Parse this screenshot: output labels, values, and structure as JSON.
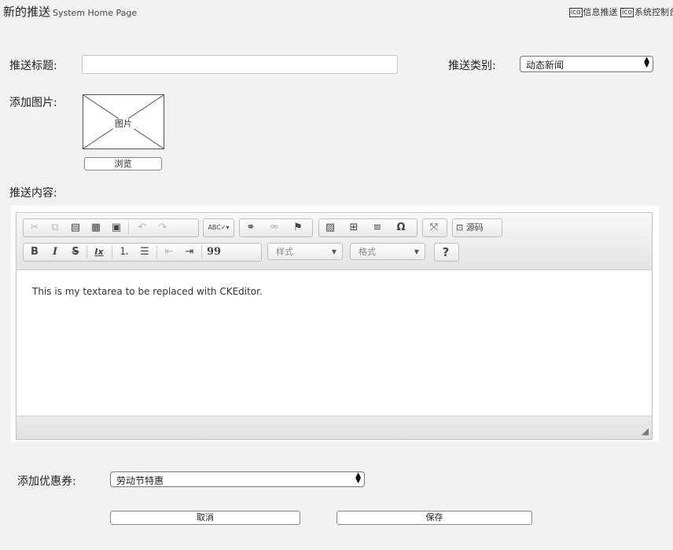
{
  "header": {
    "title": "新的推送",
    "subtitle": "System Home Page",
    "links": [
      {
        "icon": "ico",
        "label": "信息推送"
      },
      {
        "icon": "ico",
        "label": "系统控制台"
      }
    ]
  },
  "form": {
    "title_label": "推送标题:",
    "title_value": "",
    "category_label": "推送类别:",
    "category_value": "动态新闻",
    "image_label": "添加图片:",
    "image_placeholder": "图片",
    "browse_label": "浏览",
    "content_label": "推送内容:",
    "coupon_label": "添加优惠券:",
    "coupon_value": "劳动节特惠",
    "cancel_label": "取消",
    "save_label": "保存"
  },
  "editor": {
    "content_text": "This is my textarea to be replaced with CKEditor.",
    "source_label": "源码",
    "styles_label": "样式",
    "format_label": "格式",
    "bold": "B",
    "italic": "I",
    "strike": "S",
    "remove_format": "Ix",
    "quote": "99",
    "help": "?",
    "special_char": "Ω",
    "spellcheck": "ABC"
  }
}
